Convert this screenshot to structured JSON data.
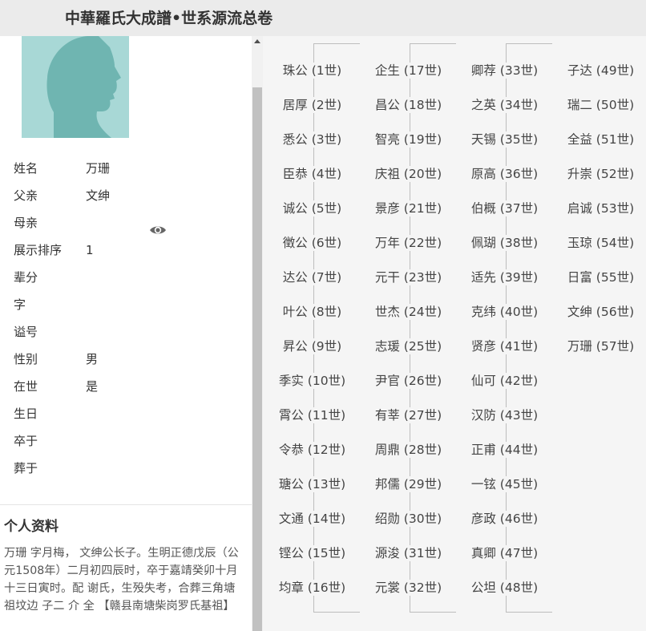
{
  "header": {
    "title": "中華羅氏大成譜•世系源流总卷"
  },
  "profile": {
    "fields": [
      {
        "label": "姓名",
        "value": "万珊"
      },
      {
        "label": "父亲",
        "value": "文绅"
      },
      {
        "label": "母亲",
        "value": ""
      },
      {
        "label": "展示排序",
        "value": "1"
      },
      {
        "label": "辈分",
        "value": ""
      },
      {
        "label": "字",
        "value": ""
      },
      {
        "label": "谥号",
        "value": ""
      },
      {
        "label": "性别",
        "value": "男"
      },
      {
        "label": "在世",
        "value": "是"
      },
      {
        "label": "生日",
        "value": ""
      },
      {
        "label": "卒于",
        "value": ""
      },
      {
        "label": "葬于",
        "value": ""
      }
    ],
    "view_icon": "eye-icon",
    "bio_title": "个人资料",
    "bio_text": "万珊 字月梅， 文绅公长子。生明正德戊辰（公元1508年）二月初四辰时，卒于嘉靖癸卯十月十三日寅时。配 谢氏，生殁失考，合葬三角塘祖坟边 子二 介 全 【赣县南塘柴岗罗氏基祖】"
  },
  "generations": [
    [
      "珠公 (1世)",
      "居厚 (2世)",
      "悉公 (3世)",
      "臣恭 (4世)",
      "诚公 (5世)",
      "徵公 (6世)",
      "达公 (7世)",
      "叶公 (8世)",
      "昇公 (9世)",
      "季实 (10世)",
      "霄公 (11世)",
      "令恭 (12世)",
      "瑭公 (13世)",
      "文通 (14世)",
      "铿公 (15世)",
      "均章 (16世)"
    ],
    [
      "企生 (17世)",
      "昌公 (18世)",
      "智亮 (19世)",
      "庆祖 (20世)",
      "景彦 (21世)",
      "万年 (22世)",
      "元干 (23世)",
      "世杰 (24世)",
      "志瑗 (25世)",
      "尹官 (26世)",
      "有莘 (27世)",
      "周鼎 (28世)",
      "邦儒 (29世)",
      "绍勋 (30世)",
      "源浚 (31世)",
      "元裳 (32世)"
    ],
    [
      "卿荐 (33世)",
      "之英 (34世)",
      "天锡 (35世)",
      "原高 (36世)",
      "伯概 (37世)",
      "佩瑚 (38世)",
      "适先 (39世)",
      "克纬 (40世)",
      "贤彦 (41世)",
      "仙可 (42世)",
      "汉防 (43世)",
      "正甫 (44世)",
      "一铉 (45世)",
      "彦政 (46世)",
      "真卿 (47世)",
      "公坦 (48世)"
    ],
    [
      "子达 (49世)",
      "瑞二 (50世)",
      "全益 (51世)",
      "升崇 (52世)",
      "启诚 (53世)",
      "玉琼 (54世)",
      "日富 (55世)",
      "文绅 (56世)",
      "万珊 (57世)"
    ]
  ]
}
